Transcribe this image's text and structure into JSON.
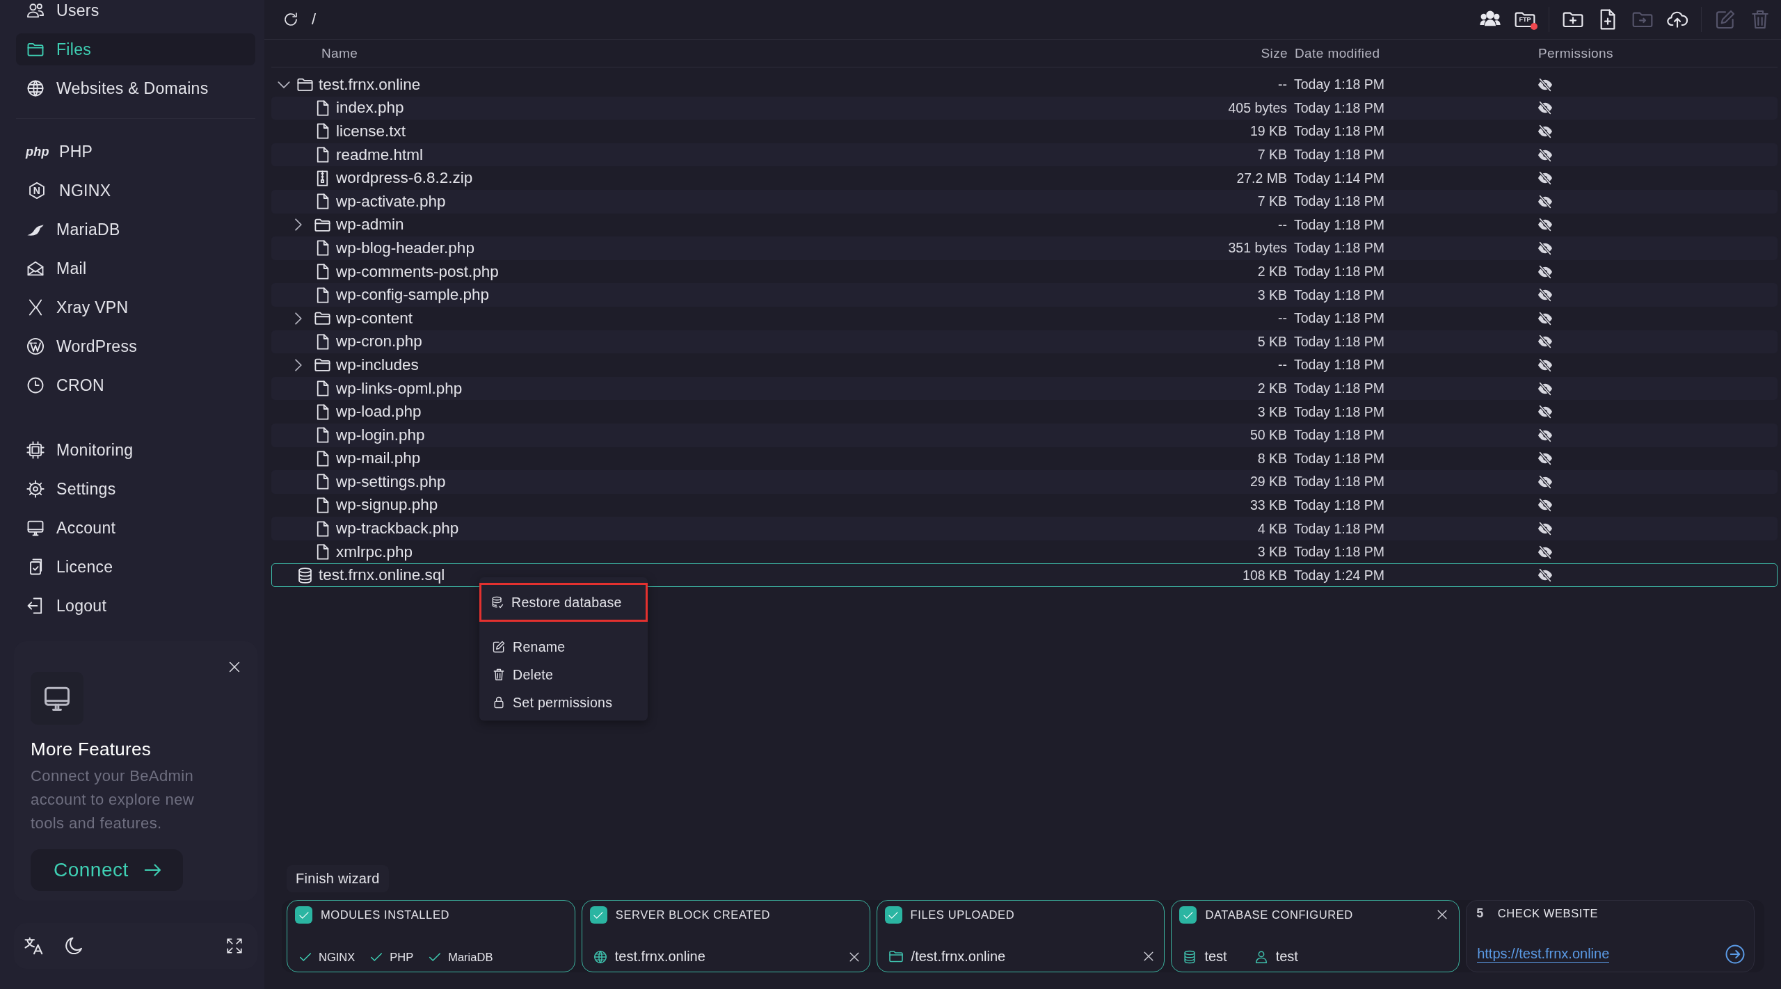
{
  "sidebar": {
    "groups": [
      {
        "items": [
          {
            "label": "Users",
            "selected": false
          },
          {
            "label": "Files",
            "selected": true
          },
          {
            "label": "Websites & Domains",
            "selected": false
          }
        ]
      },
      {
        "items": [
          {
            "label": "PHP",
            "logo_text": "php",
            "selected": false
          },
          {
            "label": "NGINX",
            "logo_text": "N",
            "selected": false
          },
          {
            "label": "MariaDB",
            "selected": false
          },
          {
            "label": "Mail",
            "selected": false
          },
          {
            "label": "Xray VPN",
            "selected": false
          },
          {
            "label": "WordPress",
            "selected": false
          },
          {
            "label": "CRON",
            "selected": false
          }
        ]
      },
      {
        "items": [
          {
            "label": "Monitoring",
            "selected": false
          },
          {
            "label": "Settings",
            "selected": false
          },
          {
            "label": "Account",
            "selected": false
          },
          {
            "label": "Licence",
            "selected": false
          },
          {
            "label": "Logout",
            "selected": false
          }
        ]
      }
    ]
  },
  "promo": {
    "title": "More Features",
    "text": "Connect your BeAdmin account to explore new tools and features.",
    "button": "Connect"
  },
  "toolbar": {
    "path": "/",
    "buttons": [
      {
        "disabled": false,
        "badge": false
      },
      {
        "label": "FTP",
        "disabled": false,
        "badge": true
      },
      {
        "disabled": false,
        "badge": false
      },
      {
        "disabled": false,
        "badge": false
      },
      {
        "disabled": true,
        "badge": false
      },
      {
        "disabled": false,
        "badge": false
      },
      {
        "disabled": true,
        "badge": false
      },
      {
        "disabled": true,
        "badge": false
      }
    ]
  },
  "table": {
    "columns": [
      "Name",
      "Size",
      "Date modified",
      "Permissions"
    ],
    "rows": [
      {
        "kind": "folder",
        "name": "test.frnx.online",
        "size": "--",
        "modified": "Today 1:18 PM",
        "expanded": true,
        "selected": false,
        "children": [
          {
            "kind": "file",
            "name": "index.php",
            "size": "405 bytes",
            "modified": "Today 1:18 PM",
            "selected": false
          },
          {
            "kind": "file",
            "name": "license.txt",
            "size": "19 KB",
            "modified": "Today 1:18 PM",
            "selected": false
          },
          {
            "kind": "file",
            "name": "readme.html",
            "size": "7 KB",
            "modified": "Today 1:18 PM",
            "selected": false
          },
          {
            "kind": "archive",
            "name": "wordpress-6.8.2.zip",
            "size": "27.2 MB",
            "modified": "Today 1:14 PM",
            "selected": false
          },
          {
            "kind": "file",
            "name": "wp-activate.php",
            "size": "7 KB",
            "modified": "Today 1:18 PM",
            "selected": false
          },
          {
            "kind": "folder",
            "name": "wp-admin",
            "size": "--",
            "modified": "Today 1:18 PM",
            "expanded": false,
            "selected": false
          },
          {
            "kind": "file",
            "name": "wp-blog-header.php",
            "size": "351 bytes",
            "modified": "Today 1:18 PM",
            "selected": false
          },
          {
            "kind": "file",
            "name": "wp-comments-post.php",
            "size": "2 KB",
            "modified": "Today 1:18 PM",
            "selected": false
          },
          {
            "kind": "file",
            "name": "wp-config-sample.php",
            "size": "3 KB",
            "modified": "Today 1:18 PM",
            "selected": false
          },
          {
            "kind": "folder",
            "name": "wp-content",
            "size": "--",
            "modified": "Today 1:18 PM",
            "expanded": false,
            "selected": false
          },
          {
            "kind": "file",
            "name": "wp-cron.php",
            "size": "5 KB",
            "modified": "Today 1:18 PM",
            "selected": false
          },
          {
            "kind": "folder",
            "name": "wp-includes",
            "size": "--",
            "modified": "Today 1:18 PM",
            "expanded": false,
            "selected": false
          },
          {
            "kind": "file",
            "name": "wp-links-opml.php",
            "size": "2 KB",
            "modified": "Today 1:18 PM",
            "selected": false
          },
          {
            "kind": "file",
            "name": "wp-load.php",
            "size": "3 KB",
            "modified": "Today 1:18 PM",
            "selected": false
          },
          {
            "kind": "file",
            "name": "wp-login.php",
            "size": "50 KB",
            "modified": "Today 1:18 PM",
            "selected": false
          },
          {
            "kind": "file",
            "name": "wp-mail.php",
            "size": "8 KB",
            "modified": "Today 1:18 PM",
            "selected": false
          },
          {
            "kind": "file",
            "name": "wp-settings.php",
            "size": "29 KB",
            "modified": "Today 1:18 PM",
            "selected": false
          },
          {
            "kind": "file",
            "name": "wp-signup.php",
            "size": "33 KB",
            "modified": "Today 1:18 PM",
            "selected": false
          },
          {
            "kind": "file",
            "name": "wp-trackback.php",
            "size": "4 KB",
            "modified": "Today 1:18 PM",
            "selected": false
          },
          {
            "kind": "file",
            "name": "xmlrpc.php",
            "size": "3 KB",
            "modified": "Today 1:18 PM",
            "selected": false
          }
        ]
      },
      {
        "kind": "database",
        "name": "test.frnx.online.sql",
        "size": "108 KB",
        "modified": "Today 1:24 PM",
        "selected": true
      }
    ]
  },
  "context_menu": {
    "groups": [
      {
        "items": [
          {
            "label": "Restore database",
            "highlighted": true
          }
        ]
      },
      {
        "items": [
          {
            "label": "Rename",
            "highlighted": false
          },
          {
            "label": "Delete",
            "highlighted": false
          },
          {
            "label": "Set permissions",
            "highlighted": false
          }
        ]
      }
    ]
  },
  "wizard": {
    "title": "Finish wizard",
    "steps": [
      {
        "kind": "modules",
        "done": true,
        "title": "MODULES INSTALLED",
        "modules": [
          "NGINX",
          "PHP",
          "MariaDB"
        ]
      },
      {
        "kind": "domain",
        "done": true,
        "title": "SERVER BLOCK CREATED",
        "value": "test.frnx.online"
      },
      {
        "kind": "folder",
        "done": true,
        "title": "FILES UPLOADED",
        "value": "/test.frnx.online"
      },
      {
        "kind": "database",
        "done": true,
        "title": "DATABASE CONFIGURED",
        "database": "test",
        "user": "test"
      },
      {
        "kind": "link",
        "done": false,
        "number": "5",
        "title": "CHECK WEBSITE",
        "link": "https://test.frnx.online"
      }
    ]
  }
}
